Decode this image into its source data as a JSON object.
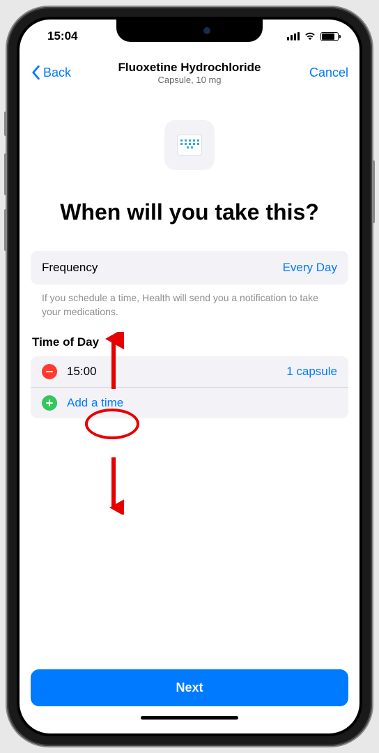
{
  "status": {
    "time": "15:04"
  },
  "nav": {
    "back_label": "Back",
    "title": "Fluoxetine Hydrochloride",
    "subtitle": "Capsule, 10 mg",
    "cancel_label": "Cancel"
  },
  "heading": "When will you take this?",
  "frequency": {
    "label": "Frequency",
    "value": "Every Day"
  },
  "hint": "If you schedule a time, Health will send you a notification to take your medications.",
  "time_section": {
    "title": "Time of Day",
    "rows": [
      {
        "time": "15:00",
        "dose": "1 capsule"
      }
    ],
    "add_label": "Add a time"
  },
  "footer": {
    "next_label": "Next"
  },
  "colors": {
    "ios_blue": "#007aff",
    "ios_red": "#ff3b30",
    "ios_green": "#34c759",
    "annotation_red": "#e60000"
  }
}
